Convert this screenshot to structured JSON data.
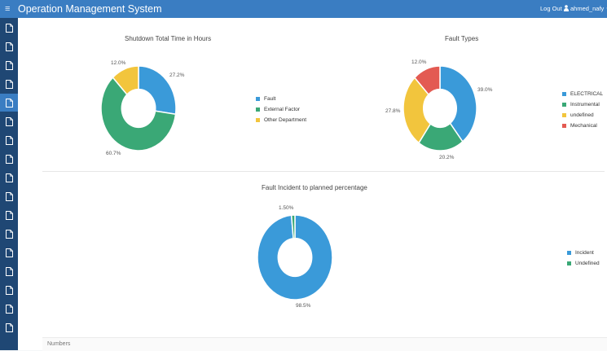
{
  "header": {
    "title": "Operation Management System",
    "logout_label": "Log Out",
    "username": "ahmed_nafy",
    "background": "#3a7dc2"
  },
  "sidebar": {
    "item_icon": "file-icon",
    "item_count": 17,
    "active_index": 4,
    "background": "#1f4774"
  },
  "charts": {
    "shutdown": {
      "title": "Shutdown Total Time in Hours",
      "labels": [
        "27.2%",
        "60.7%",
        "12.0%"
      ]
    },
    "fault_types": {
      "title": "Fault Types",
      "labels": [
        "39.0%",
        "20.2%",
        "27.8%",
        "12.0%"
      ]
    },
    "incident": {
      "title": "Fault Incident to planned percentage",
      "labels": [
        "98.5%",
        "1.50%"
      ]
    }
  },
  "footer": {
    "label": "Numbers"
  },
  "chart_data": [
    {
      "type": "pie",
      "title": "Shutdown Total Time in Hours",
      "donut": true,
      "categories": [
        "Fault",
        "External Factor",
        "Other Department"
      ],
      "values": [
        27.2,
        60.7,
        12.0
      ],
      "colors": [
        "#3a9ad9",
        "#3aa876",
        "#f2c53d"
      ],
      "legend": "right"
    },
    {
      "type": "pie",
      "title": "Fault Types",
      "donut": true,
      "categories": [
        "ELECTRICAL",
        "Instrumental",
        "undefined",
        "Mechanical"
      ],
      "values": [
        39.0,
        20.2,
        27.8,
        12.0
      ],
      "colors": [
        "#3a9ad9",
        "#3aa876",
        "#f2c53d",
        "#e35a52"
      ],
      "legend": "right"
    },
    {
      "type": "pie",
      "title": "Fault Incident to planned percentage",
      "donut": true,
      "categories": [
        "Incident",
        "Undefined"
      ],
      "values": [
        98.5,
        1.5
      ],
      "colors": [
        "#3a9ad9",
        "#3aa876"
      ],
      "legend": "right"
    }
  ]
}
